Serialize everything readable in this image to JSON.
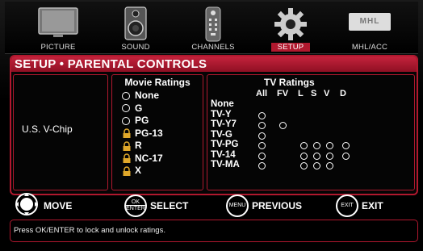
{
  "menu": [
    {
      "label": "PICTURE",
      "icon": "tv-picture-icon",
      "active": false
    },
    {
      "label": "SOUND",
      "icon": "speaker-icon",
      "active": false
    },
    {
      "label": "CHANNELS",
      "icon": "remote-icon",
      "active": false
    },
    {
      "label": "SETUP",
      "icon": "gear-icon",
      "active": true
    },
    {
      "label": "MHL/ACC",
      "icon": "mhl-logo-icon",
      "active": false
    }
  ],
  "mhl_logo_text": "MHL",
  "panel": {
    "title": "SETUP • PARENTAL CONTROLS",
    "vchip_label": "U.S. V-Chip",
    "movie_title": "Movie Ratings",
    "movie_ratings": [
      {
        "label": "None",
        "locked": false
      },
      {
        "label": "G",
        "locked": false
      },
      {
        "label": "PG",
        "locked": false
      },
      {
        "label": "PG-13",
        "locked": true
      },
      {
        "label": "R",
        "locked": true
      },
      {
        "label": "NC-17",
        "locked": true
      },
      {
        "label": "X",
        "locked": true
      }
    ],
    "tv_title": "TV Ratings",
    "tv_columns": [
      "All",
      "FV",
      "L",
      "S",
      "V",
      "D"
    ],
    "tv_rows": [
      {
        "label": "None",
        "cells": [
          false,
          false,
          false,
          false,
          false,
          false
        ]
      },
      {
        "label": "TV-Y",
        "cells": [
          true,
          false,
          false,
          false,
          false,
          false
        ]
      },
      {
        "label": "TV-Y7",
        "cells": [
          true,
          true,
          false,
          false,
          false,
          false
        ]
      },
      {
        "label": "TV-G",
        "cells": [
          true,
          false,
          false,
          false,
          false,
          false
        ]
      },
      {
        "label": "TV-PG",
        "cells": [
          true,
          false,
          true,
          true,
          true,
          true
        ]
      },
      {
        "label": "TV-14",
        "cells": [
          true,
          false,
          true,
          true,
          true,
          true
        ]
      },
      {
        "label": "TV-MA",
        "cells": [
          true,
          false,
          true,
          true,
          true,
          false
        ]
      }
    ]
  },
  "nav": {
    "move_label": "MOVE",
    "ok_line1": "OK",
    "ok_line2": "ENTER",
    "select_label": "SELECT",
    "menu_btn": "MENU",
    "previous_label": "PREVIOUS",
    "exit_btn": "EXIT",
    "exit_label": "EXIT"
  },
  "hint": "Press OK/ENTER to lock and unlock ratings.",
  "colors": {
    "accent": "#b0182e"
  }
}
